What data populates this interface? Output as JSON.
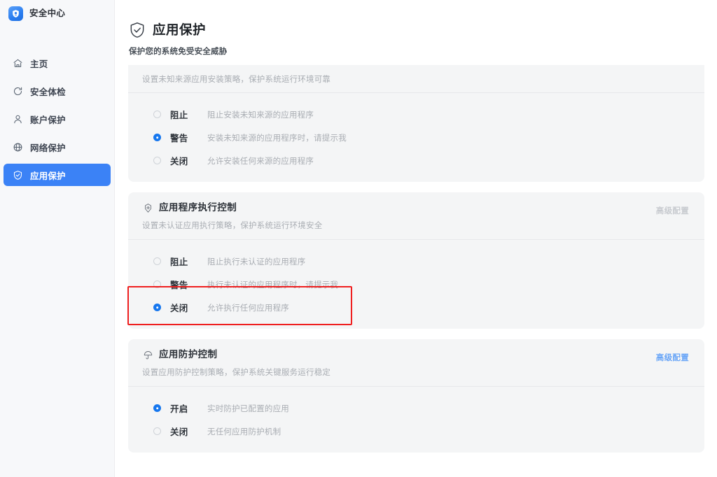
{
  "window": {
    "brand_title": "安全中心",
    "brand_logo_icon": "shield-logo-icon",
    "controls": [
      {
        "name": "menu-button",
        "icon": "hamburger-menu-icon"
      },
      {
        "name": "minimize-button",
        "icon": "minimize-icon"
      },
      {
        "name": "maximize-button",
        "icon": "maximize-icon"
      },
      {
        "name": "close-button",
        "icon": "close-icon"
      }
    ]
  },
  "sidebar": {
    "items": [
      {
        "label": "主页",
        "icon": "home-icon",
        "active": false
      },
      {
        "label": "安全体检",
        "icon": "refresh-scan-icon",
        "active": false
      },
      {
        "label": "账户保护",
        "icon": "user-icon",
        "active": false
      },
      {
        "label": "网络保护",
        "icon": "globe-icon",
        "active": false
      },
      {
        "label": "应用保护",
        "icon": "shield-check-icon",
        "active": true
      }
    ],
    "active_bg": "#3b82f6"
  },
  "page": {
    "title": "应用保护",
    "title_icon": "shield-check-icon",
    "subtitle": "保护您的系统免受安全威胁"
  },
  "cards": [
    {
      "id": "unknown-source-install",
      "clipped": true,
      "description": "设置未知来源应用安装策略，保护系统运行环境可靠",
      "options": [
        {
          "label": "阻止",
          "desc": "阻止安装未知来源的应用程序",
          "checked": false
        },
        {
          "label": "警告",
          "desc": "安装未知来源的应用程序时，请提示我",
          "checked": true
        },
        {
          "label": "关闭",
          "desc": "允许安装任何来源的应用程序",
          "checked": false
        }
      ]
    },
    {
      "id": "app-execution-control",
      "clipped": false,
      "title": "应用程序执行控制",
      "title_icon": "certificate-badge-icon",
      "description": "设置未认证应用执行策略，保护系统运行环境安全",
      "advanced_label": "高级配置",
      "advanced_enabled": false,
      "options": [
        {
          "label": "阻止",
          "desc": "阻止执行未认证的应用程序",
          "checked": false
        },
        {
          "label": "警告",
          "desc": "执行未认证的应用程序时，请提示我",
          "checked": false
        },
        {
          "label": "关闭",
          "desc": "允许执行任何应用程序",
          "checked": true,
          "highlighted": true
        }
      ]
    },
    {
      "id": "app-protection-control",
      "clipped": false,
      "title": "应用防护控制",
      "title_icon": "umbrella-icon",
      "description": "设置应用防护控制策略，保护系统关键服务运行稳定",
      "advanced_label": "高级配置",
      "advanced_enabled": true,
      "options": [
        {
          "label": "开启",
          "desc": "实时防护已配置的应用",
          "checked": true
        },
        {
          "label": "关闭",
          "desc": "无任何应用防护机制",
          "checked": false
        }
      ]
    }
  ],
  "colors": {
    "accent": "#1677ee",
    "sidebar_active": "#3b82f6",
    "card_bg": "#f4f5f6",
    "link_blue": "#6aa6f7",
    "highlight_red": "#ef1f1f"
  }
}
